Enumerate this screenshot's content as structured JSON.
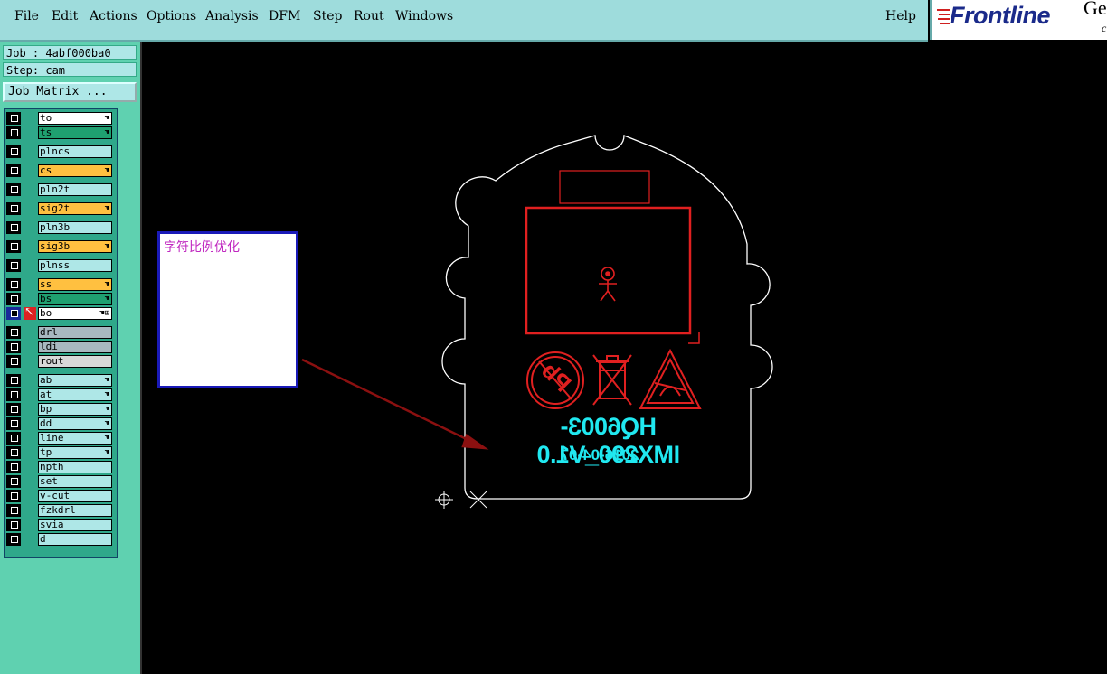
{
  "menu": {
    "items": [
      {
        "label": "File"
      },
      {
        "label": "Edit"
      },
      {
        "label": "Actions"
      },
      {
        "label": "Options"
      },
      {
        "label": "Analysis"
      },
      {
        "label": "DFM"
      },
      {
        "label": "Step"
      },
      {
        "label": "Rout"
      },
      {
        "label": "Windows"
      }
    ],
    "help": "Help"
  },
  "logo": {
    "text": "Frontline",
    "tail": "Ge",
    "c": "c"
  },
  "panel": {
    "job": "Job : 4abf000ba0",
    "step": "Step: cam",
    "job_matrix": "Job Matrix ..."
  },
  "layers": [
    {
      "name": "to",
      "color": "#ffffff",
      "mark": "hand"
    },
    {
      "name": "ts",
      "color": "#1fa070",
      "mark": "hand"
    },
    {
      "name": "plncs",
      "color": "#aee7e7",
      "mark": ""
    },
    {
      "name": "cs",
      "color": "#ffc040",
      "mark": "hand"
    },
    {
      "name": "pln2t",
      "color": "#aee7e7",
      "mark": ""
    },
    {
      "name": "sig2t",
      "color": "#ffc040",
      "mark": "hand"
    },
    {
      "name": "pln3b",
      "color": "#aee7e7",
      "mark": ""
    },
    {
      "name": "sig3b",
      "color": "#ffc040",
      "mark": "hand"
    },
    {
      "name": "plnss",
      "color": "#aee7e7",
      "mark": ""
    },
    {
      "name": "ss",
      "color": "#ffc040",
      "mark": "hand"
    },
    {
      "name": "bs",
      "color": "#1fa070",
      "mark": "hand"
    },
    {
      "name": "bo",
      "color": "#ffffff",
      "mark": "hand-box",
      "selected": true
    },
    {
      "name": "drl",
      "color": "#a8b8c0",
      "mark": ""
    },
    {
      "name": "ldi",
      "color": "#a8b8c0",
      "mark": ""
    },
    {
      "name": "rout",
      "color": "#d8d8d8",
      "mark": ""
    },
    {
      "name": "ab",
      "color": "#aee7e7",
      "mark": "hand"
    },
    {
      "name": "at",
      "color": "#aee7e7",
      "mark": "hand"
    },
    {
      "name": "bp",
      "color": "#aee7e7",
      "mark": "hand"
    },
    {
      "name": "dd",
      "color": "#aee7e7",
      "mark": "hand"
    },
    {
      "name": "line",
      "color": "#aee7e7",
      "mark": "hand"
    },
    {
      "name": "tp",
      "color": "#aee7e7",
      "mark": "hand"
    },
    {
      "name": "npth",
      "color": "#aee7e7",
      "mark": ""
    },
    {
      "name": "set",
      "color": "#aee7e7",
      "mark": ""
    },
    {
      "name": "v-cut",
      "color": "#aee7e7",
      "mark": ""
    },
    {
      "name": "fzkdrl",
      "color": "#aee7e7",
      "mark": ""
    },
    {
      "name": "svia",
      "color": "#aee7e7",
      "mark": ""
    },
    {
      "name": "d",
      "color": "#aee7e7",
      "mark": ""
    }
  ],
  "canvas": {
    "note": "字符比例优化",
    "silk_line1": "HQ6003-IMX290_V1.0",
    "silk_line2": "2016-04-07",
    "pb_label": "Pb",
    "colors": {
      "outline": "#ffffff",
      "red": "#e02020",
      "cyan": "#20e8f0",
      "arrow": "#8b1010"
    }
  }
}
